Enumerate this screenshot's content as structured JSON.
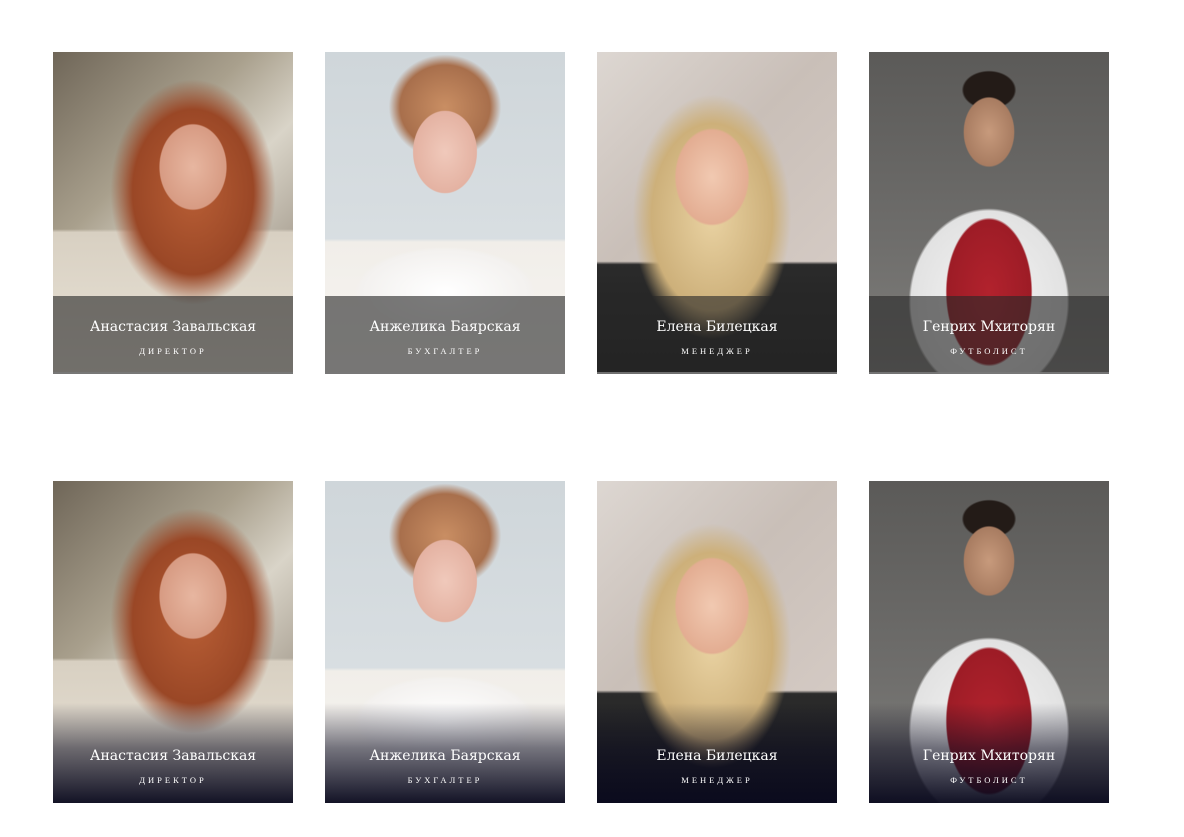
{
  "rows": [
    {
      "style": "dark-band",
      "cards": [
        {
          "name": "Анастасия Завальская",
          "role": "директор"
        },
        {
          "name": "Анжелика Баярская",
          "role": "бухгалтер"
        },
        {
          "name": "Елена Билецкая",
          "role": "менеджер"
        },
        {
          "name": "Генрих Мхиторян",
          "role": "футболист"
        }
      ]
    },
    {
      "style": "gradient",
      "cards": [
        {
          "name": "Анастасия Завальская",
          "role": "директор"
        },
        {
          "name": "Анжелика Баярская",
          "role": "бухгалтер"
        },
        {
          "name": "Елена Билецкая",
          "role": "менеджер"
        },
        {
          "name": "Генрих Мхиторян",
          "role": "футболист"
        }
      ]
    }
  ],
  "colors": {
    "band_overlay": "#282828",
    "gradient_overlay_end": "#0a0a1e",
    "text": "#ffffff"
  }
}
